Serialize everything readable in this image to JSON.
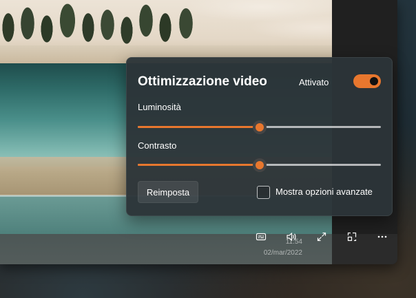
{
  "flyout": {
    "title": "Ottimizzazione video",
    "toggle": {
      "label": "Attivato",
      "on": true
    },
    "brightness": {
      "label": "Luminosità",
      "value": 0.5
    },
    "contrast": {
      "label": "Contrasto",
      "value": 0.5
    },
    "reset_label": "Reimposta",
    "advanced": {
      "label": "Mostra opzioni avanzate",
      "checked": false
    }
  },
  "player": {
    "time": "11:54",
    "date": "02/mar/2022",
    "controls": [
      {
        "name": "captions-icon"
      },
      {
        "name": "volume-icon"
      },
      {
        "name": "fullscreen-icon"
      },
      {
        "name": "mini-player-icon"
      },
      {
        "name": "more-options-icon"
      }
    ]
  },
  "colors": {
    "accent": "#e8772e",
    "flyout_bg": "#2c3438"
  }
}
